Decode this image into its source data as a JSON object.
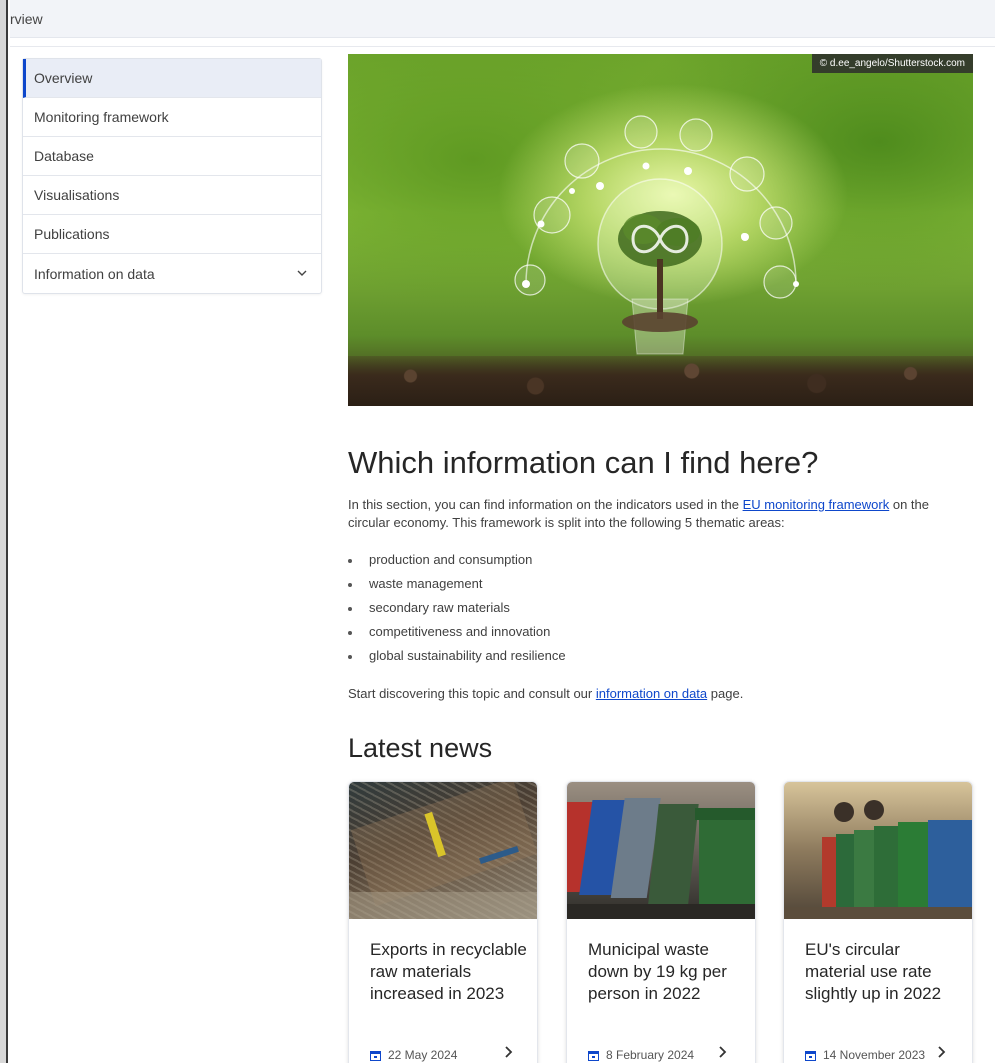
{
  "breadcrumb": "rview",
  "sidebar": {
    "items": [
      {
        "label": "Overview"
      },
      {
        "label": "Monitoring framework"
      },
      {
        "label": "Database"
      },
      {
        "label": "Visualisations"
      },
      {
        "label": "Publications"
      },
      {
        "label": "Information on data"
      }
    ]
  },
  "hero": {
    "credit": "© d.ee_angelo/Shutterstock.com"
  },
  "info": {
    "heading": "Which information can I find here?",
    "p1_before": "In this section, you can find information on the indicators used in the ",
    "p1_link": "EU monitoring framework",
    "p1_after": " on the circular economy. This framework is split into the following 5 thematic areas:",
    "areas": [
      "production and consumption",
      "waste management",
      "secondary raw materials",
      "competitiveness and innovation",
      "global sustainability and resilience"
    ],
    "p2_before": "Start discovering this topic and consult our ",
    "p2_link": "information on data",
    "p2_after": " page."
  },
  "news": {
    "heading": "Latest news",
    "cards": [
      {
        "title": "Exports in recyclable raw materials increased in 2023",
        "date": "22 May 2024"
      },
      {
        "title": "Municipal waste down by 19 kg per person in 2022",
        "date": "8 February 2024"
      },
      {
        "title": "EU's circular material use rate slightly up in 2022",
        "date": "14 November 2023"
      }
    ]
  },
  "colors": {
    "accent": "#0e47cb",
    "active_bg": "#e9edf6",
    "heading": "#262626"
  }
}
